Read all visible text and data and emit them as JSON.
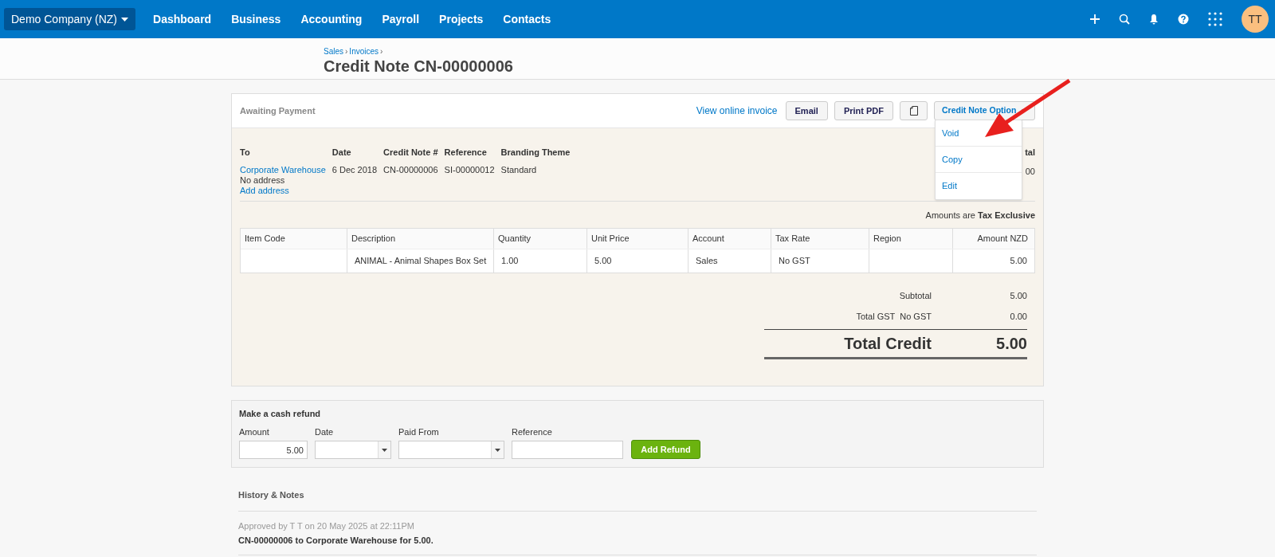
{
  "nav": {
    "org": "Demo Company (NZ)",
    "items": [
      "Dashboard",
      "Business",
      "Accounting",
      "Payroll",
      "Projects",
      "Contacts"
    ],
    "avatar": "TT"
  },
  "breadcrumb": [
    {
      "text": "Sales",
      "separator": "›"
    },
    {
      "text": "Invoices",
      "separator": "›"
    }
  ],
  "title": "Credit Note CN-00000006",
  "status": "Awaiting Payment",
  "actions": {
    "link": "View online invoice",
    "buttons": [
      "Email",
      "Print PDF"
    ],
    "options": "Credit Note Option"
  },
  "menu": [
    "Void",
    "Copy",
    "Edit"
  ],
  "details": [
    {
      "label": "To",
      "values": [
        {
          "text": "Corporate Warehouse",
          "link": true
        },
        {
          "text": "No address",
          "link": false
        },
        {
          "text": "Add address",
          "link": true
        }
      ]
    },
    {
      "label": "Date",
      "values": [
        {
          "text": "6 Dec 2018",
          "link": false
        }
      ]
    },
    {
      "label": "Credit Note #",
      "values": [
        {
          "text": "CN-00000006",
          "link": false
        }
      ]
    },
    {
      "label": "Reference",
      "values": [
        {
          "text": "SI-00000012",
          "link": false
        }
      ]
    },
    {
      "label": "Branding Theme",
      "values": [
        {
          "text": "Standard",
          "link": false
        }
      ]
    }
  ],
  "total_column": {
    "label": "tal",
    "value": "00"
  },
  "tax_note": {
    "prefix": "Amounts are",
    "value": "Tax Exclusive"
  },
  "table": {
    "columns": [
      "Item Code",
      "Description",
      "Quantity",
      "Unit Price",
      "Account",
      "Tax Rate",
      "Region",
      "Amount NZD"
    ],
    "rows": [
      [
        "",
        "ANIMAL - Animal Shapes Box Set",
        "1.00",
        "5.00",
        "Sales",
        "No GST",
        "",
        "5.00"
      ]
    ]
  },
  "totals": [
    {
      "label": "Subtotal",
      "value": "5.00"
    },
    {
      "label": "Total GST  No GST",
      "value": "0.00"
    }
  ],
  "grand_total": {
    "label": "Total Credit",
    "value": "5.00"
  },
  "refund": {
    "title": "Make a cash refund",
    "fields": [
      {
        "label": "Amount",
        "value": "5.00",
        "kind": "text"
      },
      {
        "label": "Date",
        "kind": "select"
      },
      {
        "label": "Paid From",
        "kind": "select"
      },
      {
        "label": "Reference",
        "kind": "text"
      }
    ],
    "button": "Add Refund"
  },
  "history": {
    "title": "History & Notes",
    "entries": [
      {
        "meta": "Approved by T T on 20 May 2025 at 22:11PM",
        "text": "CN-00000006 to Corporate Warehouse for 5.00."
      }
    ]
  }
}
